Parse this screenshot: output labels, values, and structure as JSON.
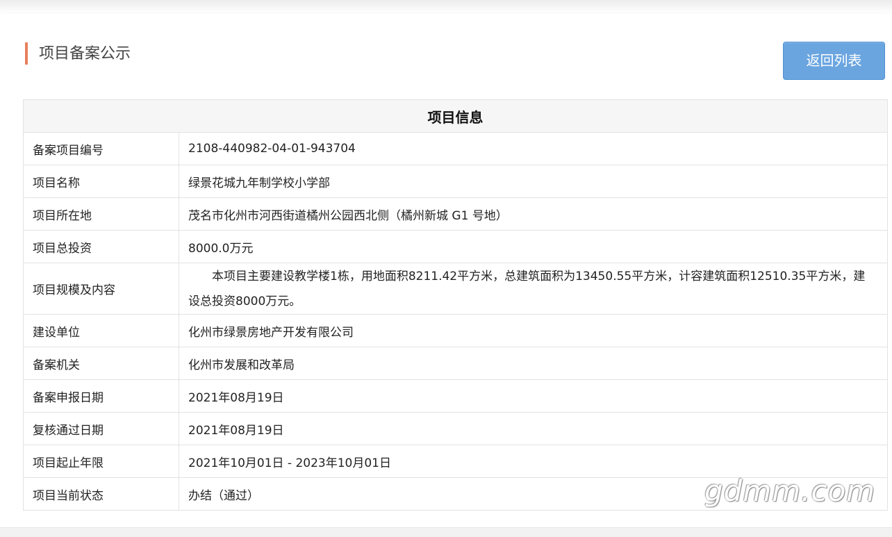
{
  "page": {
    "title": "项目备案公示",
    "back_button_label": "返回列表"
  },
  "table": {
    "header": "项目信息",
    "rows": [
      {
        "label": "备案项目编号",
        "value": "2108-440982-04-01-943704"
      },
      {
        "label": "项目名称",
        "value": "绿景花城九年制学校小学部"
      },
      {
        "label": "项目所在地",
        "value": "茂名市化州市河西街道橘州公园西北侧（橘州新城 G1 号地）"
      },
      {
        "label": "项目总投资",
        "value": "8000.0万元"
      },
      {
        "label": "项目规模及内容",
        "value": "本项目主要建设教学楼1栋，用地面积8211.42平方米，总建筑面积为13450.55平方米，计容建筑面积12510.35平方米，建设总投资8000万元。"
      },
      {
        "label": "建设单位",
        "value": "化州市绿景房地产开发有限公司"
      },
      {
        "label": "备案机关",
        "value": "化州市发展和改革局"
      },
      {
        "label": "备案申报日期",
        "value": "2021年08月19日"
      },
      {
        "label": "复核通过日期",
        "value": "2021年08月19日"
      },
      {
        "label": "项目起止年限",
        "value": "2021年10月01日 - 2023年10月01日"
      },
      {
        "label": "项目当前状态",
        "value": "办结（通过）"
      }
    ]
  },
  "watermark": "gdmm.com",
  "colors": {
    "accent_bar": "#e8805c",
    "button_bg": "#6aa5e0",
    "table_border": "#e2e2e2",
    "header_bg": "#f6f6f6"
  }
}
